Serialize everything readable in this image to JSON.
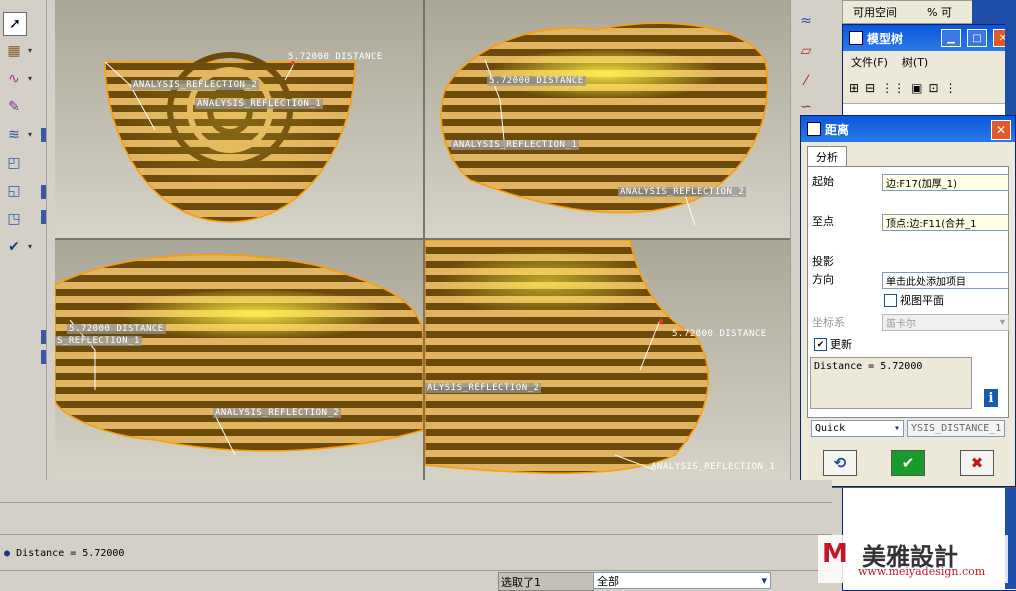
{
  "viewports": {
    "top_left": {
      "distance_label": "5.72000  DISTANCE",
      "reflection_2": "ANALYSIS_REFLECTION_2",
      "reflection_1": "ANALYSIS_REFLECTION_1"
    },
    "top_right": {
      "distance_label": "5.72000  DISTANCE",
      "reflection_1": "ANALYSIS_REFLECTION_1",
      "reflection_2": "ANALYSIS_REFLECTION_2"
    },
    "bottom_left": {
      "distance_label": "5.72000  DISTANCE",
      "reflection_1": "S_REFLECTION_1",
      "reflection_2": "ANALYSIS_REFLECTION_2"
    },
    "bottom_right": {
      "distance_label": "5.72000  DISTANCE",
      "reflection_2": "ALYSIS_REFLECTION_2",
      "reflection_1": "ANALYSIS_REFLECTION_1"
    }
  },
  "top_status": {
    "available_space": "可用空间",
    "percent": "% 可"
  },
  "model_tree": {
    "title": "模型树",
    "menu": {
      "file": "文件(F)",
      "tree": "树(T)"
    }
  },
  "dialog": {
    "title": "距离",
    "tab": "分析",
    "from_label": "起始",
    "from_value": "边:F17(加厚_1)",
    "to_label": "至点",
    "to_value": "顶点:边:F11(合并_1",
    "projection_label": "投影",
    "direction_label": "方向",
    "direction_placeholder": "单击此处添加项目",
    "view_plane": "视图平面",
    "csys_label": "坐标系",
    "csys_value": "笛卡尔",
    "update_label": "更新",
    "result": "Distance = 5.72000",
    "mode": "Quick",
    "analysis_name": "YSIS_DISTANCE_1"
  },
  "message_line": "Distance = 5.72000",
  "status_bar": {
    "selected": "选取了1",
    "filter": "全部"
  },
  "watermark": {
    "brand": "美雅設計",
    "url": "www.meiyadesign.com"
  },
  "colors": {
    "surface_dark": "#6b4a0a",
    "surface_light": "#e8c060",
    "highlight": "#ffe838",
    "edge": "#ff9c00"
  }
}
